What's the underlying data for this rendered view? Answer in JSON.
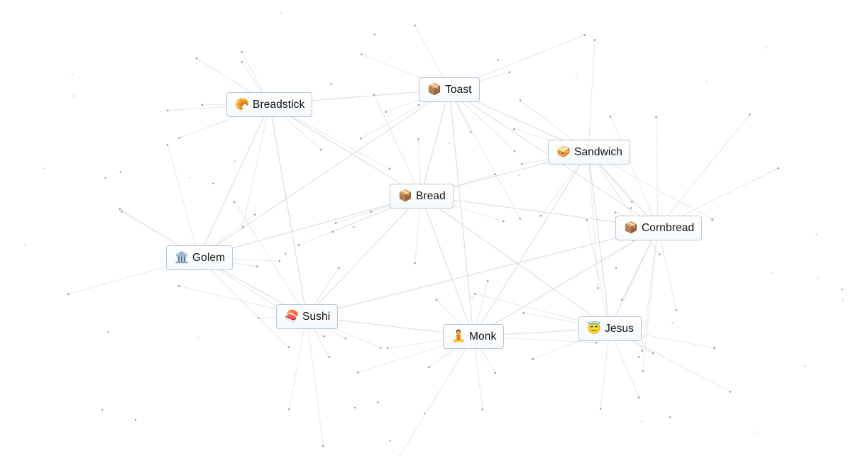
{
  "canvas": {
    "edge_color": "#d9d9d9",
    "dot_color": "#9a9a9a",
    "node_border_color": "#b3c6d8"
  },
  "nodes": [
    {
      "id": "breadstick",
      "label": "Breadstick",
      "emoji": "🥐",
      "icon": "croissant-icon"
    },
    {
      "id": "toast",
      "label": "Toast",
      "emoji": "📦",
      "icon": "box-icon"
    },
    {
      "id": "sandwich",
      "label": "Sandwich",
      "emoji": "🥪",
      "icon": "sandwich-icon"
    },
    {
      "id": "bread",
      "label": "Bread",
      "emoji": "📦",
      "icon": "box-icon"
    },
    {
      "id": "cornbread",
      "label": "Cornbread",
      "emoji": "📦",
      "icon": "box-icon"
    },
    {
      "id": "golem",
      "label": "Golem",
      "emoji": "🏛️",
      "icon": "classical-building-icon"
    },
    {
      "id": "sushi",
      "label": "Sushi",
      "emoji": "🍣",
      "icon": "sushi-icon"
    },
    {
      "id": "monk",
      "label": "Monk",
      "emoji": "🧘",
      "icon": "person-in-lotus-position-icon"
    },
    {
      "id": "jesus",
      "label": "Jesus",
      "emoji": "😇",
      "icon": "smiling-face-with-halo-icon"
    }
  ],
  "edges": [
    [
      "breadstick",
      "toast"
    ],
    [
      "breadstick",
      "bread"
    ],
    [
      "breadstick",
      "golem"
    ],
    [
      "breadstick",
      "sushi"
    ],
    [
      "toast",
      "bread"
    ],
    [
      "toast",
      "sandwich"
    ],
    [
      "toast",
      "monk"
    ],
    [
      "toast",
      "cornbread"
    ],
    [
      "sandwich",
      "bread"
    ],
    [
      "sandwich",
      "cornbread"
    ],
    [
      "sandwich",
      "jesus"
    ],
    [
      "sandwich",
      "monk"
    ],
    [
      "bread",
      "golem"
    ],
    [
      "bread",
      "sushi"
    ],
    [
      "bread",
      "monk"
    ],
    [
      "bread",
      "cornbread"
    ],
    [
      "bread",
      "jesus"
    ],
    [
      "golem",
      "sushi"
    ],
    [
      "sushi",
      "monk"
    ],
    [
      "monk",
      "jesus"
    ],
    [
      "monk",
      "cornbread"
    ],
    [
      "jesus",
      "cornbread"
    ],
    [
      "sushi",
      "cornbread"
    ],
    [
      "golem",
      "toast"
    ]
  ]
}
